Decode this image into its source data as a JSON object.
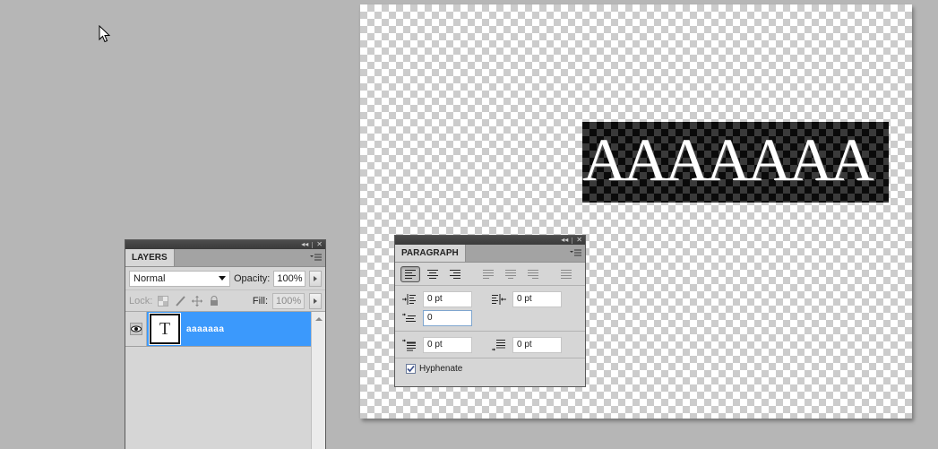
{
  "canvas": {
    "text_layer_content": "AAAAAAA"
  },
  "layers_panel": {
    "tab_label": "LAYERS",
    "blend_mode": "Normal",
    "opacity_label": "Opacity:",
    "opacity_value": "100%",
    "lock_label": "Lock:",
    "fill_label": "Fill:",
    "fill_value": "100%",
    "layers": [
      {
        "name": "aaaaaaa",
        "type_glyph": "T",
        "visible": true,
        "selected": true
      }
    ]
  },
  "paragraph_panel": {
    "tab_label": "PARAGRAPH",
    "alignment_buttons": [
      {
        "name": "align-left",
        "active": true
      },
      {
        "name": "align-center",
        "active": false
      },
      {
        "name": "align-right",
        "active": false
      },
      {
        "name": "justify-last-left",
        "active": false
      },
      {
        "name": "justify-last-center",
        "active": false
      },
      {
        "name": "justify-last-right",
        "active": false
      },
      {
        "name": "justify-all",
        "active": false
      }
    ],
    "indent_left": "0 pt",
    "indent_right": "0 pt",
    "indent_first_line": "0",
    "space_before": "0 pt",
    "space_after": "0 pt",
    "hyphenate_label": "Hyphenate",
    "hyphenate_checked": true
  },
  "colors": {
    "selection_blue": "#3b99fc",
    "workspace_gray": "#b6b6b6",
    "panel_gray": "#d6d6d6"
  }
}
